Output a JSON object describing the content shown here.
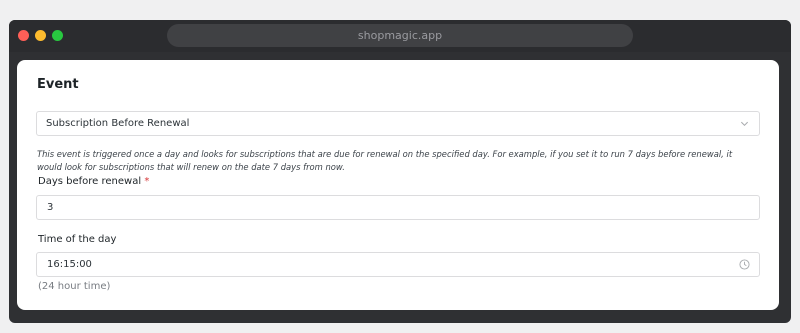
{
  "browser": {
    "url": "shopmagic.app"
  },
  "event": {
    "title": "Event",
    "selected": "Subscription Before Renewal",
    "description": "This event is triggered once a day and looks for subscriptions that are due for renewal on the specified day. For example, if you set it to run 7 days before renewal, it would look for subscriptions that will renew on the date 7 days from now."
  },
  "days_field": {
    "label": "Days before renewal",
    "required_marker": "*",
    "value": "3"
  },
  "time_field": {
    "label": "Time of the day",
    "value": "16:15:00",
    "hint": "(24 hour time)"
  },
  "icons": {
    "select_arrow": "chevron-down-icon",
    "time_picker": "clock-icon"
  },
  "colors": {
    "close": "#ff5f57",
    "minimize": "#febc2e",
    "maximize": "#28c840",
    "required": "#d63638"
  }
}
